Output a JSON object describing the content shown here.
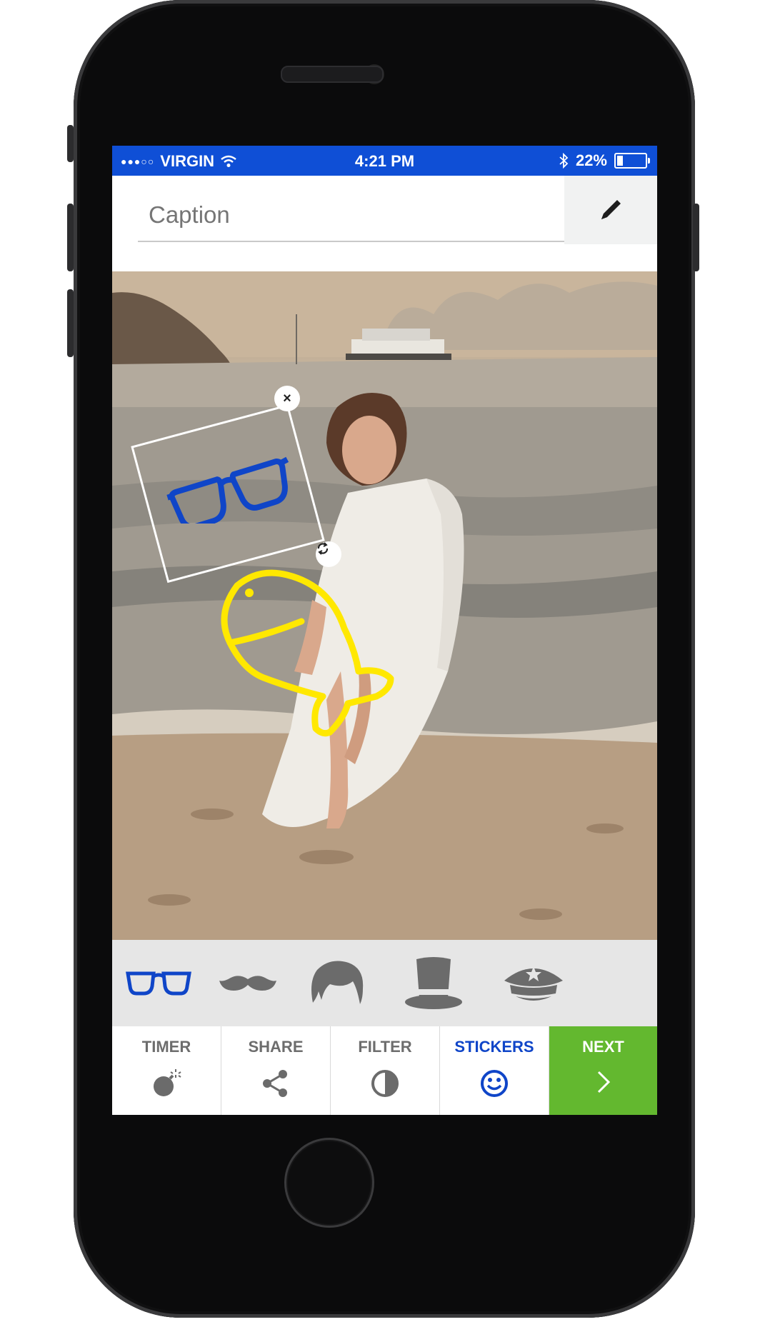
{
  "status_bar": {
    "carrier": "VIRGIN",
    "time": "4:21 PM",
    "battery_percent": "22%",
    "battery_level": 0.22,
    "signal_icon": "signal-dots-icon",
    "wifi_icon": "wifi-icon",
    "bluetooth_icon": "bluetooth-icon"
  },
  "caption": {
    "placeholder": "Caption",
    "value": "",
    "edit_icon": "pencil-icon"
  },
  "photo": {
    "description_icon": "beach-photo",
    "active_sticker": {
      "name": "glasses",
      "color": "#0f45c8",
      "delete_icon": "close-icon",
      "rotate_icon": "rotate-icon"
    },
    "drawing": {
      "name": "fish-drawing",
      "color": "#ffe800"
    }
  },
  "sticker_tray": {
    "items": [
      {
        "name": "glasses",
        "icon": "glasses-icon",
        "color": "#0f45c8",
        "selected": true
      },
      {
        "name": "mustache",
        "icon": "mustache-icon",
        "color": "#6b6b6b",
        "selected": false
      },
      {
        "name": "hair",
        "icon": "hair-icon",
        "color": "#6b6b6b",
        "selected": false
      },
      {
        "name": "top-hat",
        "icon": "top-hat-icon",
        "color": "#6b6b6b",
        "selected": false
      },
      {
        "name": "police-cap",
        "icon": "police-cap-icon",
        "color": "#6b6b6b",
        "selected": false
      }
    ]
  },
  "toolbar": {
    "timer_label": "TIMER",
    "share_label": "SHARE",
    "filter_label": "FILTER",
    "stickers_label": "STICKERS",
    "next_label": "NEXT",
    "active": "STICKERS",
    "accent_color": "#0f45c8",
    "next_color": "#63b82f"
  }
}
